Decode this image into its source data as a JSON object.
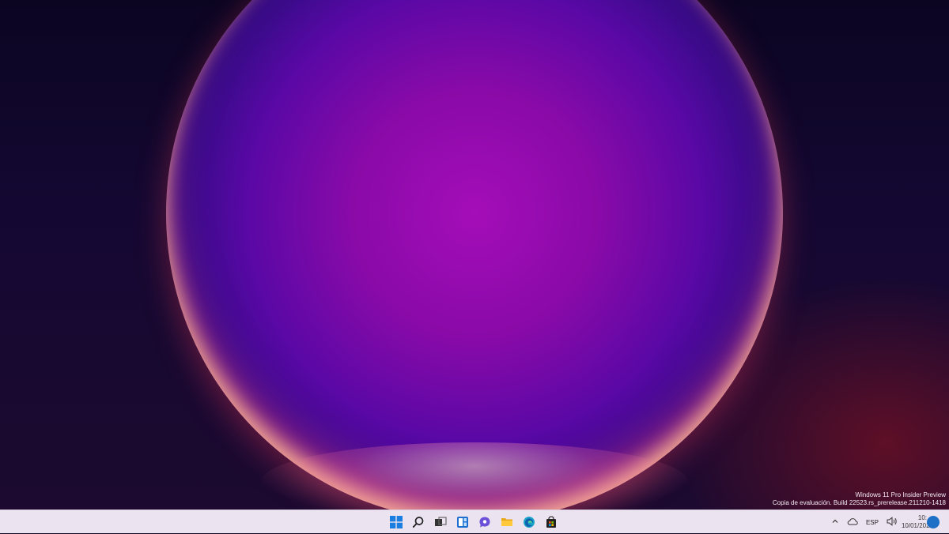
{
  "watermark": {
    "line1": "Windows 11 Pro Insider Preview",
    "line2": "Copia de evaluación. Build 22523.rs_prerelease.211210-1418"
  },
  "taskbar": {
    "pinned": [
      {
        "name": "start-button",
        "icon": "windows-logo-icon"
      },
      {
        "name": "search-button",
        "icon": "search-icon"
      },
      {
        "name": "task-view-button",
        "icon": "task-view-icon"
      },
      {
        "name": "widgets-button",
        "icon": "widgets-icon"
      },
      {
        "name": "chat-button",
        "icon": "chat-icon"
      },
      {
        "name": "file-explorer-button",
        "icon": "folder-icon"
      },
      {
        "name": "edge-button",
        "icon": "edge-icon"
      },
      {
        "name": "store-button",
        "icon": "store-icon"
      }
    ],
    "tray": {
      "language": "ESP",
      "time": "10:…",
      "date": "10/01/2022"
    }
  },
  "colors": {
    "taskbar_bg": "#ece3f0",
    "accent": "#1e6fc6"
  }
}
